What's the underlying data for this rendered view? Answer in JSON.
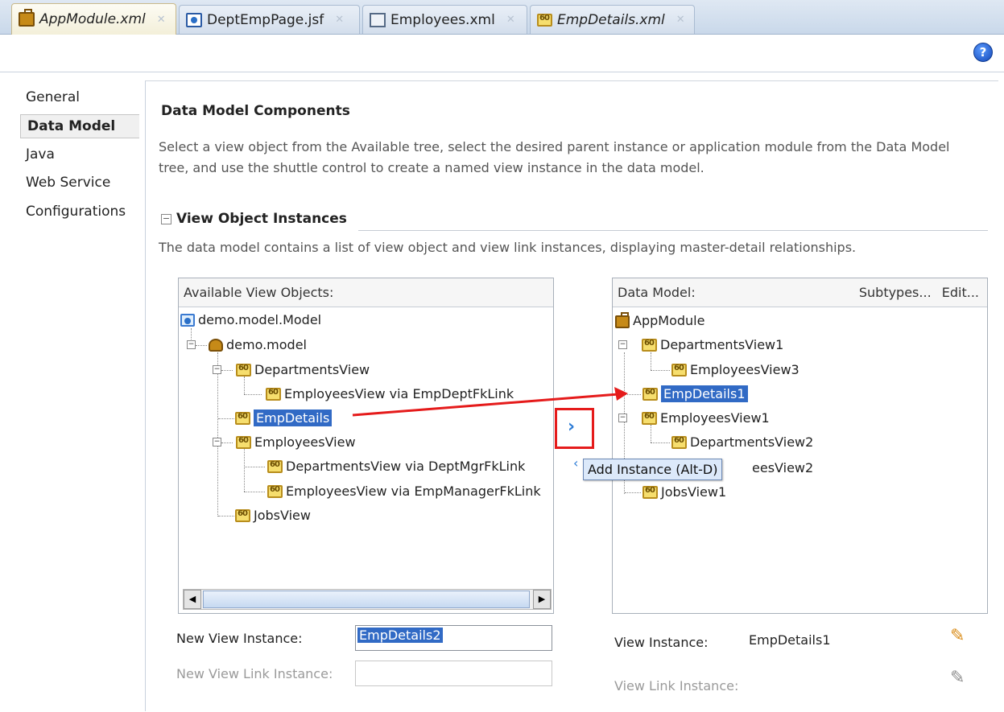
{
  "tabs": [
    {
      "label": "AppModule.xml",
      "icon": "suitcase-icon",
      "italic": true,
      "active": true
    },
    {
      "label": "DeptEmpPage.jsf",
      "icon": "jsf-page-icon",
      "italic": false,
      "active": false
    },
    {
      "label": "Employees.xml",
      "icon": "entity-icon",
      "italic": false,
      "active": false
    },
    {
      "label": "EmpDetails.xml",
      "icon": "view-object-icon",
      "italic": true,
      "active": false
    }
  ],
  "help": {
    "glyph": "?"
  },
  "nav": {
    "items": [
      "General",
      "Data Model",
      "Java",
      "Web Service",
      "Configurations"
    ],
    "selected": "Data Model"
  },
  "main": {
    "title": "Data Model Components",
    "description": "Select a view object from the Available tree, select the desired parent instance or application module from the Data Model tree, and use the shuttle control to create a named view instance in the data model.",
    "section_title": "View Object Instances",
    "section_toggle": "−",
    "section_description": "The data model contains a list of view object and view link instances, displaying master-detail relationships."
  },
  "available": {
    "header": "Available View Objects:",
    "nodes": [
      {
        "label": "demo.model.Model"
      },
      {
        "label": "demo.model"
      },
      {
        "label": "DepartmentsView"
      },
      {
        "label": "EmployeesView via EmpDeptFkLink"
      },
      {
        "label": "EmpDetails"
      },
      {
        "label": "EmployeesView"
      },
      {
        "label": "DepartmentsView via DeptMgrFkLink"
      },
      {
        "label": "EmployeesView via EmpManagerFkLink"
      },
      {
        "label": "JobsView"
      }
    ]
  },
  "datamodel": {
    "header": "Data Model:",
    "subtypes": "Subtypes...",
    "edit": "Edit...",
    "nodes": [
      {
        "label": "AppModule"
      },
      {
        "label": "DepartmentsView1"
      },
      {
        "label": "EmployeesView3"
      },
      {
        "label": "EmpDetails1"
      },
      {
        "label": "EmployeesView1"
      },
      {
        "label": "DepartmentsView2"
      },
      {
        "label": "eesView2"
      },
      {
        "label": "JobsView1"
      }
    ]
  },
  "shuttle": {
    "add_glyph": "›",
    "remove_glyph": "‹",
    "tooltip": "Add Instance (Alt-D)"
  },
  "form": {
    "new_view_instance_label": "New View Instance:",
    "new_view_instance_value": "EmpDetails2",
    "new_view_link_instance_label": "New View Link Instance:",
    "view_instance_label": "View Instance:",
    "view_instance_value": "EmpDetails1",
    "view_link_instance_label": "View Link Instance:"
  },
  "colors": {
    "selection": "#316ac5",
    "highlight_red": "#e51b1b",
    "accent_blue": "#2b7bd6"
  }
}
